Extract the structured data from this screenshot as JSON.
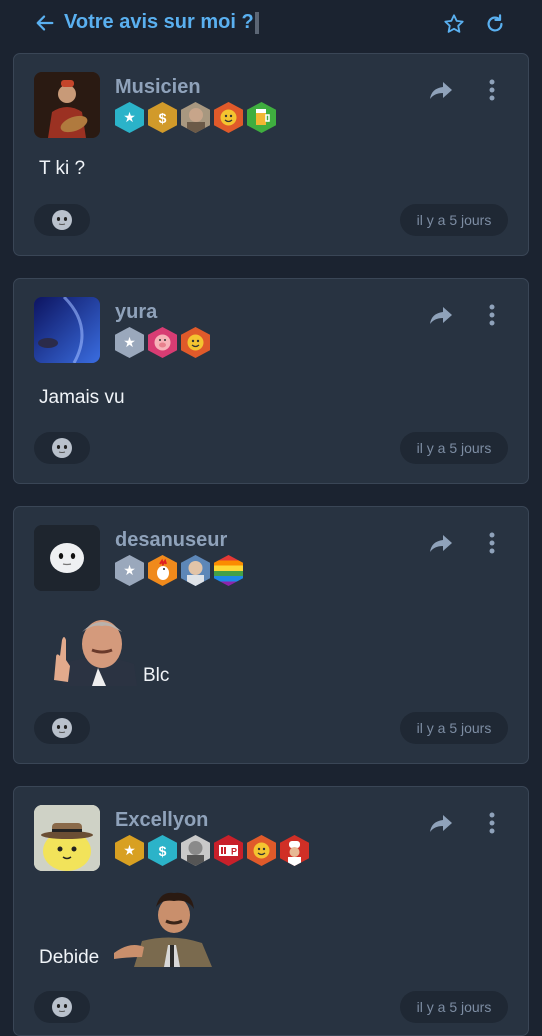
{
  "header": {
    "title": "Votre avis sur moi ?",
    "back_icon": "arrow-left-icon",
    "favorite_icon": "star-outline-icon",
    "refresh_icon": "refresh-icon",
    "accent": "#5ab0f0"
  },
  "reactions_label_icon": "smiley-face-icon",
  "comments": [
    {
      "username": "Musicien",
      "content": "T ki ?",
      "time": "il y a 5 jours",
      "badges": [
        "star-badge",
        "dollar-badge",
        "portrait-badge",
        "smiley-badge",
        "beer-badge"
      ]
    },
    {
      "username": "yura",
      "content": "Jamais vu",
      "time": "il y a 5 jours",
      "badges": [
        "star-badge",
        "pig-face-badge",
        "smiley-badge"
      ]
    },
    {
      "username": "desanuseur",
      "content": "Blc",
      "time": "il y a 5 jours",
      "badges": [
        "star-badge",
        "rooster-badge",
        "portrait-badge",
        "rainbow-badge"
      ]
    },
    {
      "username": "Excellyon",
      "content": "Debide",
      "time": "il y a 5 jours",
      "badges": [
        "star-badge",
        "dollar-badge",
        "portrait-badge",
        "p-logo-badge",
        "smiley-badge",
        "chef-badge"
      ]
    }
  ],
  "badge_letters": {
    "dollar": "$",
    "p_logo": "P"
  }
}
